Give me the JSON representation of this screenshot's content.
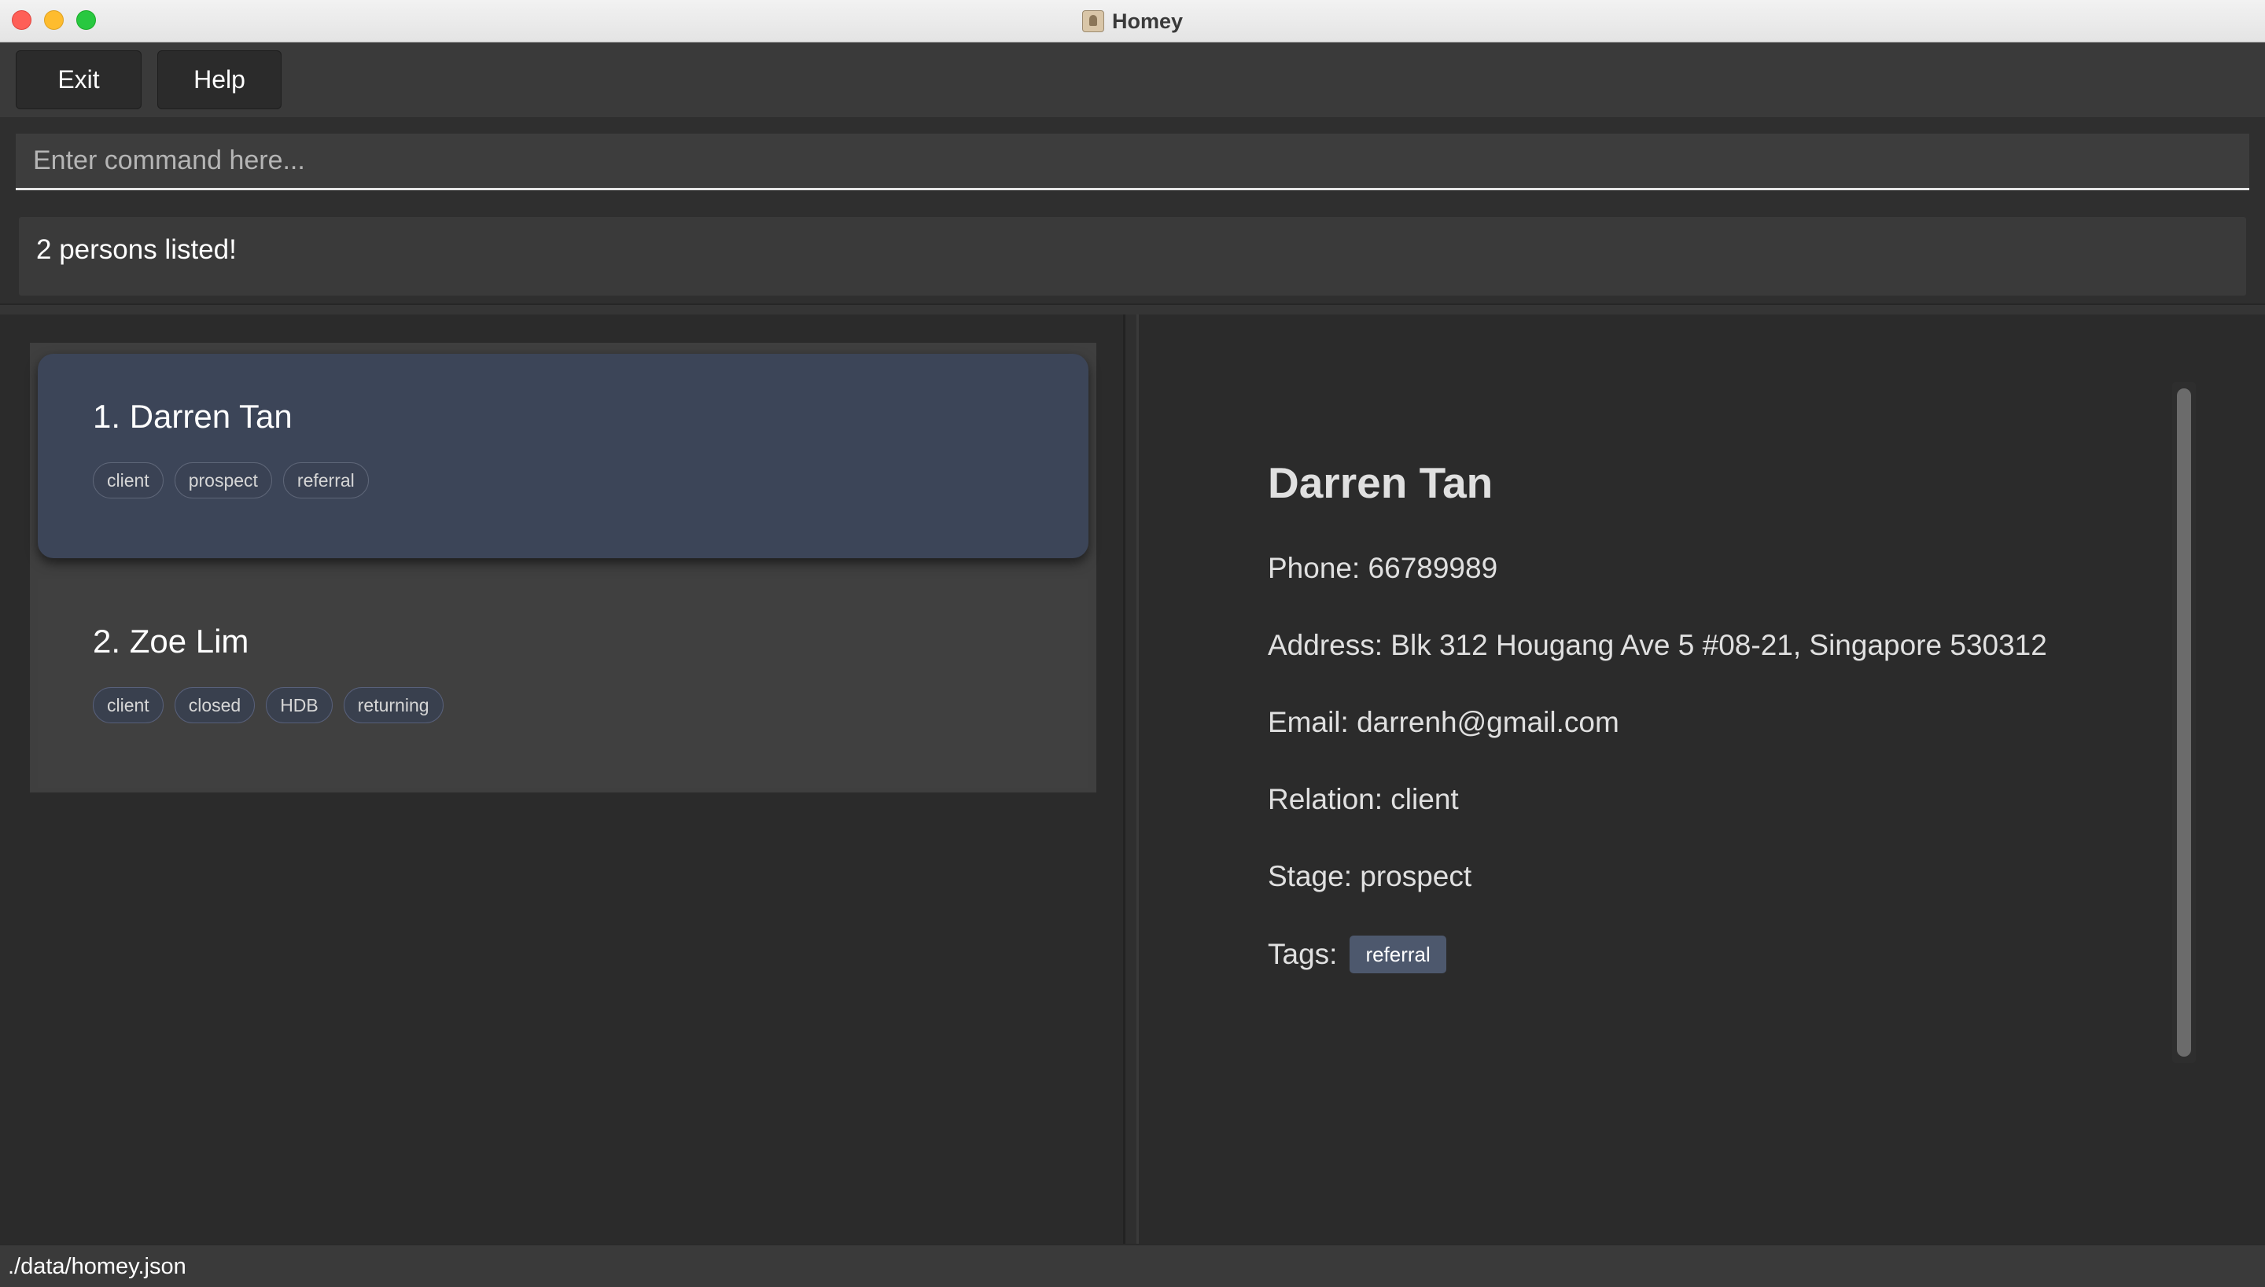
{
  "window": {
    "title": "Homey",
    "app_icon": "contact-book-icon"
  },
  "menu": {
    "exit_label": "Exit",
    "help_label": "Help"
  },
  "command": {
    "placeholder": "Enter command here...",
    "value": ""
  },
  "result": {
    "message": "2 persons listed!"
  },
  "persons": [
    {
      "index_name": "1.  Darren Tan",
      "selected": true,
      "tags": [
        "client",
        "prospect",
        "referral"
      ]
    },
    {
      "index_name": "2.  Zoe Lim",
      "selected": false,
      "tags": [
        "client",
        "closed",
        "HDB",
        "returning"
      ]
    }
  ],
  "detail": {
    "name": "Darren Tan",
    "phone": "Phone: 66789989",
    "address": "Address: Blk 312 Hougang Ave 5 #08-21, Singapore 530312",
    "email": "Email: darrenh@gmail.com",
    "relation": "Relation: client",
    "stage": "Stage: prospect",
    "tags_label": "Tags:",
    "tags": [
      "referral"
    ]
  },
  "status": {
    "file_path": "./data/homey.json"
  },
  "colors": {
    "background": "#2b2b2b",
    "selected_card": "#3c4558",
    "tag_chip": "#4d586d"
  }
}
